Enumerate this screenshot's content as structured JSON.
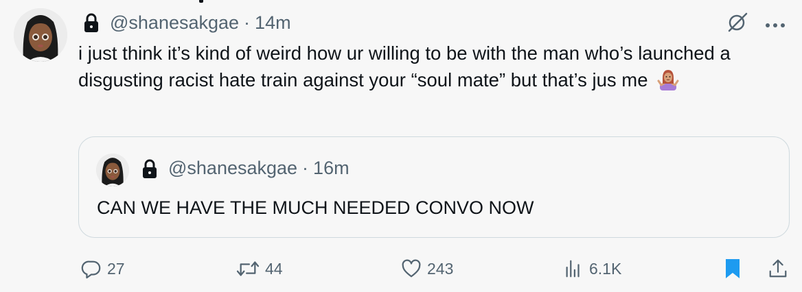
{
  "tweet": {
    "handle": "@shanesakgae",
    "separator": "·",
    "time": "14m",
    "text": "i just think it’s kind of weird how ur willing to be with the man who’s launched a disgusting racist hate train against your “soul mate” but that’s jus me",
    "emoji_icon": "person-shrugging-emoji"
  },
  "quote": {
    "handle": "@shanesakgae",
    "separator": "·",
    "time": "16m",
    "text": "CAN WE HAVE THE MUCH NEEDED CONVO NOW"
  },
  "actions": {
    "reply_count": "27",
    "repost_count": "44",
    "like_count": "243",
    "view_count": "6.1K"
  },
  "icons": {
    "protected": "lock-icon",
    "grok": "grok-icon",
    "more": "more-icon",
    "reply": "reply-icon",
    "repost": "repost-icon",
    "like": "heart-icon",
    "views": "views-icon",
    "bookmark": "bookmark-icon",
    "share": "share-icon"
  },
  "colors": {
    "accent": "#1d9bf0",
    "muted": "#536471",
    "text": "#0f1419",
    "border": "#cfd9de"
  }
}
